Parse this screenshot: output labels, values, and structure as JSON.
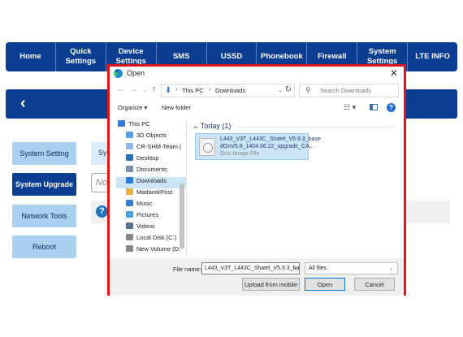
{
  "nav": {
    "items": [
      {
        "label": "Home"
      },
      {
        "label": "Quick\nSettings"
      },
      {
        "label": "Device\nSettings"
      },
      {
        "label": "SMS"
      },
      {
        "label": "USSD"
      },
      {
        "label": "Phonebook"
      },
      {
        "label": "Firewall"
      },
      {
        "label": "System\nSettings"
      },
      {
        "label": "LTE INFO"
      }
    ]
  },
  "header": {
    "back_icon": "‹"
  },
  "sidebar": {
    "items": [
      {
        "label": "System Setting",
        "active": false
      },
      {
        "label": "System Upgrade",
        "active": true
      },
      {
        "label": "Network Tools",
        "active": false
      },
      {
        "label": "Reboot",
        "active": false
      }
    ]
  },
  "main": {
    "section_title": "Sy",
    "file_input_placeholder": "No",
    "help_icon": "?"
  },
  "dialog": {
    "title": "Open",
    "close": "✕",
    "address": {
      "crumb1": "This PC",
      "crumb2": "Downloads"
    },
    "search_placeholder": "Search Downloads",
    "toolbar": {
      "organize": "Organize ▾",
      "new_folder": "New folder"
    },
    "tree": [
      {
        "label": "This PC",
        "color": "#3a7bd5"
      },
      {
        "label": "3D Objects",
        "color": "#5aa0e0"
      },
      {
        "label": "CR-SHM-Team (",
        "color": "#8fb8e8"
      },
      {
        "label": "Desktop",
        "color": "#2a6fbf"
      },
      {
        "label": "Documents",
        "color": "#7d8ea8"
      },
      {
        "label": "Downloads",
        "color": "#2d7ad6"
      },
      {
        "label": "MadarekPost",
        "color": "#e8b341"
      },
      {
        "label": "Music",
        "color": "#3a7bd5"
      },
      {
        "label": "Pictures",
        "color": "#4aa0d8"
      },
      {
        "label": "Videos",
        "color": "#5a6f8a"
      },
      {
        "label": "Local Disk (C:)",
        "color": "#888888"
      },
      {
        "label": "New Volume (D:",
        "color": "#888888"
      }
    ],
    "group_header": "Today (1)",
    "file": {
      "name_line1": "L443_V3T_L443C_Shatel_V5.9.3_base",
      "name_line2": "dOnV5.8_1404.06.22_upgrade_CA...",
      "type": "Disc Image File"
    },
    "file_name_label": "File name:",
    "file_name_value": "L443_V3T_L443C_Shatel_V5.9.3_bas",
    "file_type": "All files",
    "buttons": {
      "upload_mobile": "Upload from mobile",
      "open": "Open",
      "cancel": "Cancel"
    }
  },
  "colors": {
    "nav_bg": "#0b3d91",
    "highlight_border": "#e0151b",
    "sidebar_bg": "#a9d0ef"
  }
}
